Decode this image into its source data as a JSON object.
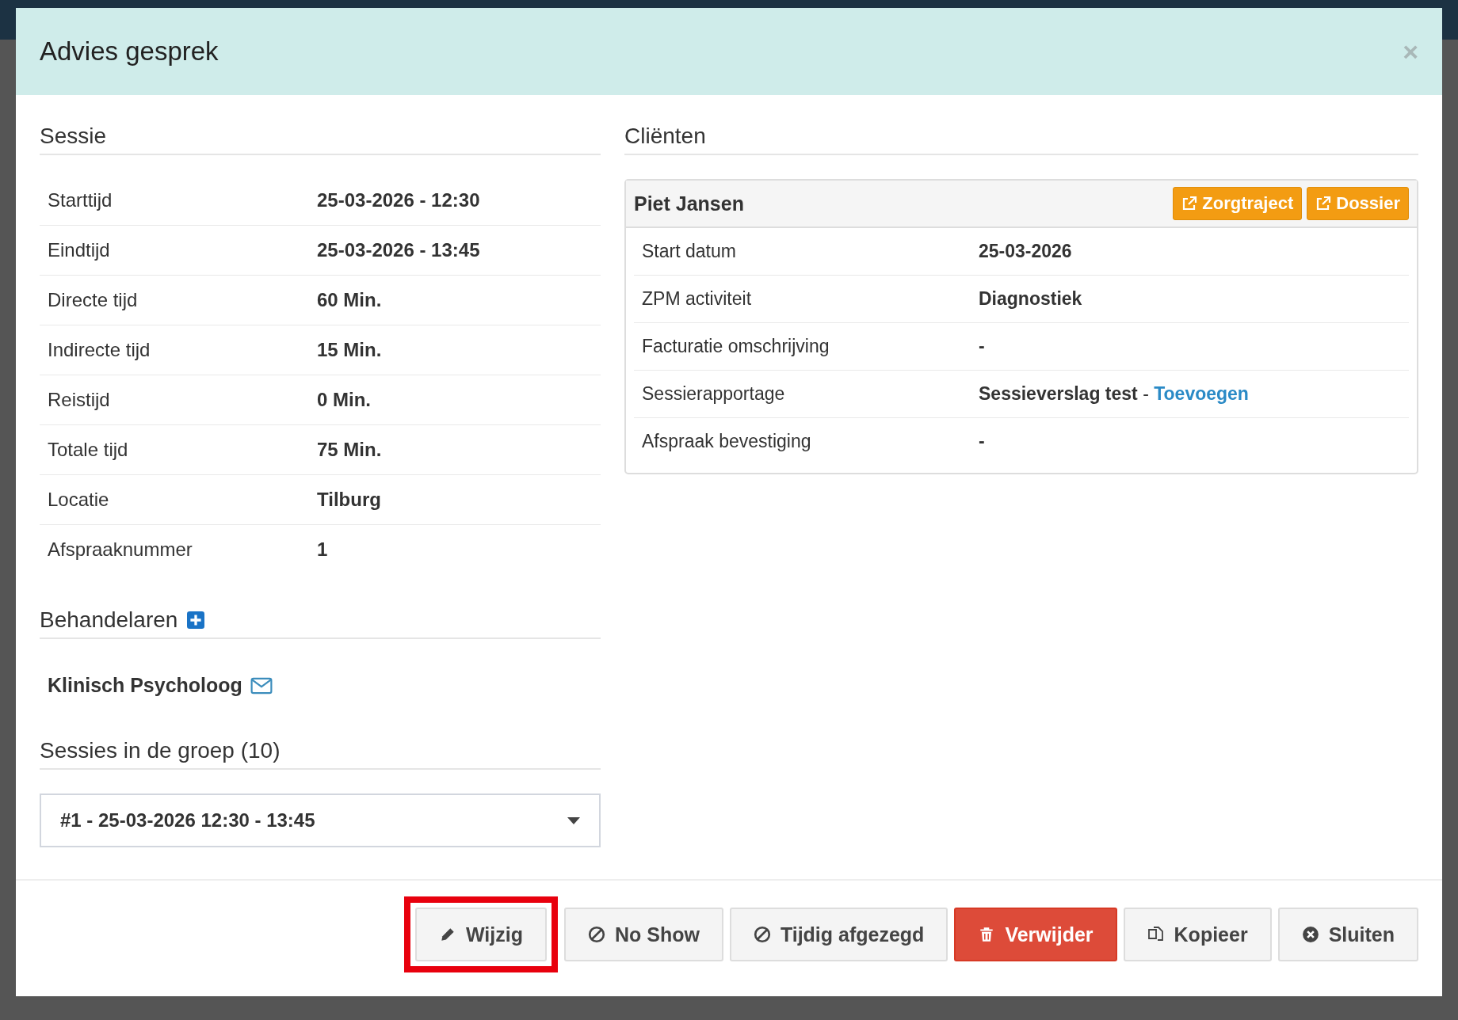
{
  "modal": {
    "title": "Advies gesprek",
    "close": "×"
  },
  "session": {
    "heading": "Sessie",
    "rows": [
      {
        "label": "Starttijd",
        "value": "25-03-2026 - 12:30"
      },
      {
        "label": "Eindtijd",
        "value": "25-03-2026 - 13:45"
      },
      {
        "label": "Directe tijd",
        "value": "60 Min."
      },
      {
        "label": "Indirecte tijd",
        "value": "15 Min."
      },
      {
        "label": "Reistijd",
        "value": "0 Min."
      },
      {
        "label": "Totale tijd",
        "value": "75 Min."
      },
      {
        "label": "Locatie",
        "value": "Tilburg"
      },
      {
        "label": "Afspraaknummer",
        "value": "1"
      }
    ]
  },
  "practitioners": {
    "heading": "Behandelaren",
    "items": [
      {
        "name": "Klinisch Psycholoog"
      }
    ]
  },
  "group": {
    "heading": "Sessies in de groep (10)",
    "selected_value": "#1 - 25-03-2026 12:30 - 13:45"
  },
  "clients": {
    "heading": "Cliënten",
    "cards": [
      {
        "name": "Piet Jansen",
        "buttons": [
          "Zorgtraject",
          "Dossier"
        ],
        "rows": [
          {
            "label": "Start datum",
            "value": "25-03-2026"
          },
          {
            "label": "ZPM activiteit",
            "value": "Diagnostiek"
          },
          {
            "label": "Facturatie omschrijving",
            "value": "-"
          },
          {
            "label": "Sessierapportage",
            "value": "Sessieverslag test",
            "separator": "-",
            "link": "Toevoegen"
          },
          {
            "label": "Afspraak bevestiging",
            "value": "-"
          }
        ]
      }
    ]
  },
  "footer_buttons": [
    {
      "label": "Wijzig",
      "kind": "edit",
      "highlighted": true
    },
    {
      "label": "No Show",
      "kind": "ban",
      "highlighted": false
    },
    {
      "label": "Tijdig afgezegd",
      "kind": "ban",
      "highlighted": false
    },
    {
      "label": "Verwijder",
      "kind": "delete",
      "highlighted": false
    },
    {
      "label": "Kopieer",
      "kind": "copy",
      "highlighted": false
    },
    {
      "label": "Sluiten",
      "kind": "close",
      "highlighted": false
    }
  ]
}
